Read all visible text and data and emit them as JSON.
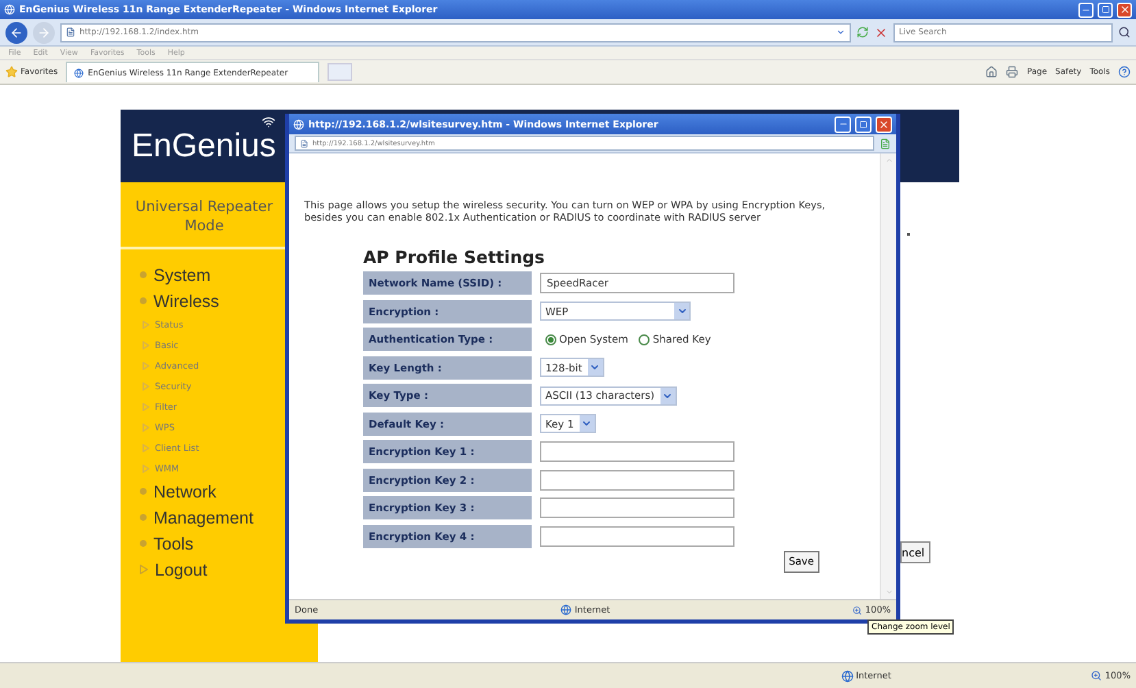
{
  "window": {
    "title": "EnGenius Wireless 11n Range ExtenderRepeater - Windows Internet Explorer"
  },
  "address_bar": {
    "url": "http://192.168.1.2/index.htm"
  },
  "search": {
    "placeholder": "Live Search"
  },
  "menu_bar": [
    "File",
    "Edit",
    "View",
    "Favorites",
    "Tools",
    "Help"
  ],
  "favorites_bar": {
    "label": "Favorites",
    "tab": "EnGenius Wireless 11n Range ExtenderRepeater",
    "commands": [
      "Page",
      "Safety",
      "Tools"
    ]
  },
  "page": {
    "logo": "EnGenius",
    "mode": "Universal Repeater Mode",
    "nav": [
      {
        "label": "System",
        "kind": "dot"
      },
      {
        "label": "Wireless",
        "kind": "dot",
        "children": [
          "Status",
          "Basic",
          "Advanced",
          "Security",
          "Filter",
          "WPS",
          "Client List",
          "WMM"
        ]
      },
      {
        "label": "Network",
        "kind": "dot"
      },
      {
        "label": "Management",
        "kind": "dot"
      },
      {
        "label": "Tools",
        "kind": "dot"
      },
      {
        "label": "Logout",
        "kind": "arrow"
      }
    ],
    "cancel_button": "ncel"
  },
  "popup": {
    "title": "http://192.168.1.2/wlsitesurvey.htm - Windows Internet Explorer",
    "url": "http://192.168.1.2/wlsitesurvey.htm",
    "intro": "This page allows you setup the wireless security. You can turn on WEP or WPA by using Encryption Keys, besides you can enable 802.1x Authentication or RADIUS to coordinate with RADIUS server",
    "heading": "AP Profile Settings",
    "rows": [
      {
        "label": "Network Name (SSID) :",
        "kind": "text",
        "value": "SpeedRacer"
      },
      {
        "label": "Encryption :",
        "kind": "select",
        "value": "WEP"
      },
      {
        "label": "Authentication Type :",
        "kind": "radio",
        "options": [
          {
            "label": "Open System",
            "selected": true
          },
          {
            "label": "Shared Key",
            "selected": false
          }
        ]
      },
      {
        "label": "Key Length :",
        "kind": "select",
        "value": "128-bit"
      },
      {
        "label": "Key Type :",
        "kind": "select",
        "value": "ASCII (13 characters)"
      },
      {
        "label": "Default Key :",
        "kind": "select",
        "value": "Key 1"
      },
      {
        "label": "Encryption Key 1 :",
        "kind": "text"
      },
      {
        "label": "Encryption Key 2 :",
        "kind": "text"
      },
      {
        "label": "Encryption Key 3 :",
        "kind": "text"
      },
      {
        "label": "Encryption Key 4 :",
        "kind": "text"
      }
    ],
    "save_button": "Save",
    "status_bar": {
      "status": "Done",
      "zone": "Internet",
      "zoom": "100%"
    }
  },
  "tooltip": "Change zoom level",
  "status_bar": {
    "zone": "Internet",
    "zoom": "100%"
  }
}
